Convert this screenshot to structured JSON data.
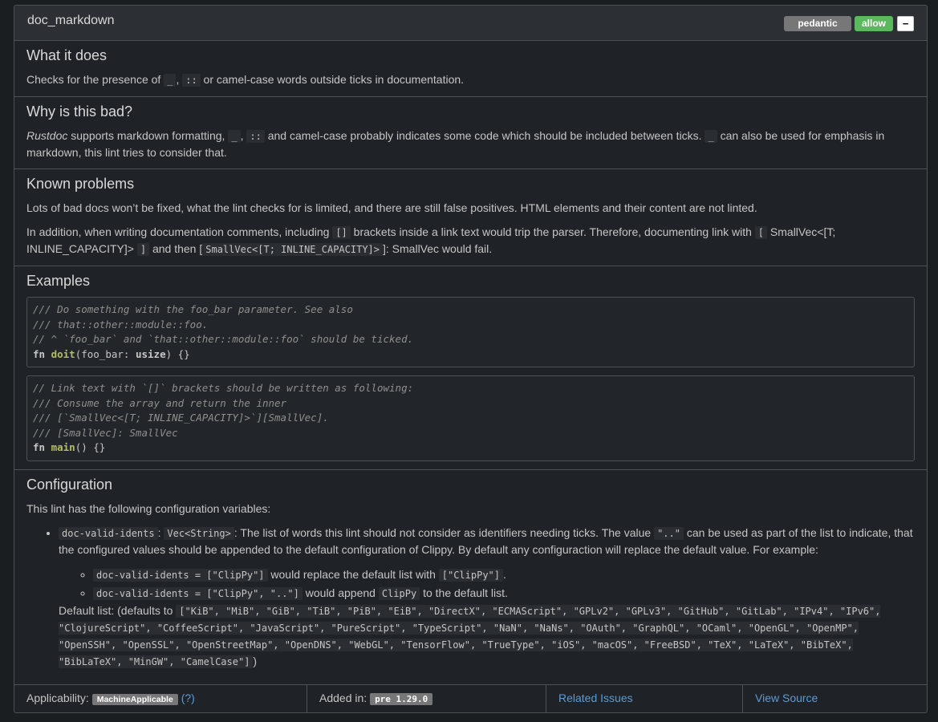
{
  "lint": {
    "name": "doc_markdown",
    "group": "pedantic",
    "level": "allow",
    "toggle": "−"
  },
  "what": {
    "title": "What it does",
    "t1": "Checks for the presence of ",
    "c1": "_",
    "t2": ", ",
    "c2": "::",
    "t3": " or camel-case words outside ticks in documentation."
  },
  "why": {
    "title": "Why is this bad?",
    "em": "Rustdoc",
    "t1": " supports markdown formatting, ",
    "c1": "_",
    "t2": ", ",
    "c2": "::",
    "t3": " and camel-case probably indicates some code which should be included between ticks. ",
    "c3": "_",
    "t4": " can also be used for emphasis in markdown, this lint tries to consider that."
  },
  "known": {
    "title": "Known problems",
    "p1": "Lots of bad docs won’t be fixed, what the lint checks for is limited, and there are still false positives. HTML elements and their content are not linted.",
    "p2_t1": "In addition, when writing documentation comments, including ",
    "p2_c1": "[]",
    "p2_t2": " brackets inside a link text would trip the parser. Therefore, documenting link with ",
    "p2_c2": "[",
    "p2_t3": " SmallVec<[T; INLINE_CAPACITY]> ",
    "p2_c3": "]",
    "p2_t4": " and then [",
    "p2_c4": "SmallVec<[T; INLINE_CAPACITY]>",
    "p2_t5": "]: SmallVec would fail."
  },
  "examples": {
    "title": "Examples",
    "ex1": {
      "l1": "/// Do something with the foo_bar parameter. See also",
      "l2": "/// that::other::module::foo.",
      "l3": "// ^ `foo_bar` and `that::other::module::foo` should be ticked.",
      "kw": "fn",
      "name": "doit",
      "p1": "(foo_bar: ",
      "ty": "usize",
      "p2": ") {}"
    },
    "ex2": {
      "l1": "// Link text with `[]` brackets should be written as following:",
      "l2": "/// Consume the array and return the inner",
      "l3": "/// [`SmallVec<[T; INLINE_CAPACITY]>`][SmallVec].",
      "l4": "/// [SmallVec]: SmallVec",
      "kw": "fn",
      "name": "main",
      "p1": "() {}"
    }
  },
  "config": {
    "title": "Configuration",
    "intro": "This lint has the following configuration variables:",
    "var": "doc-valid-idents",
    "sep": ": ",
    "type": "Vec<String>",
    "desc1": ": The list of words this lint should not consider as identifiers needing ticks. The value ",
    "dots": "\"..\"",
    "desc2": " can be used as part of the list to indicate, that the configured values should be appended to the default configuration of Clippy. By default any configuraction will replace the default value. For example:",
    "ex1_code": "doc-valid-idents = [\"ClipPy\"]",
    "ex1_text": " would replace the default list with ",
    "ex1_val": "[\"ClipPy\"]",
    "ex1_end": ".",
    "ex2_code": "doc-valid-idents = [\"ClipPy\", \"..\"]",
    "ex2_text": " would append ",
    "ex2_val": "ClipPy",
    "ex2_end": " to the default list.",
    "default_prefix": "Default list: (defaults to ",
    "default_value": "[\"KiB\", \"MiB\", \"GiB\", \"TiB\", \"PiB\", \"EiB\", \"DirectX\", \"ECMAScript\", \"GPLv2\", \"GPLv3\", \"GitHub\", \"GitLab\", \"IPv4\", \"IPv6\", \"ClojureScript\", \"CoffeeScript\", \"JavaScript\", \"PureScript\", \"TypeScript\", \"NaN\", \"NaNs\", \"OAuth\", \"GraphQL\", \"OCaml\", \"OpenGL\", \"OpenMP\", \"OpenSSH\", \"OpenSSL\", \"OpenStreetMap\", \"OpenDNS\", \"WebGL\", \"TensorFlow\", \"TrueType\", \"iOS\", \"macOS\", \"FreeBSD\", \"TeX\", \"LaTeX\", \"BibTeX\", \"BibLaTeX\", \"MinGW\", \"CamelCase\"]",
    "default_suffix": ")"
  },
  "footer": {
    "applicability_label": "Applicability: ",
    "applicability_value": "MachineApplicable",
    "help": "(?)",
    "added_label": "Added in: ",
    "added_value": "pre 1.29.0",
    "related": "Related Issues",
    "source": "View Source"
  }
}
